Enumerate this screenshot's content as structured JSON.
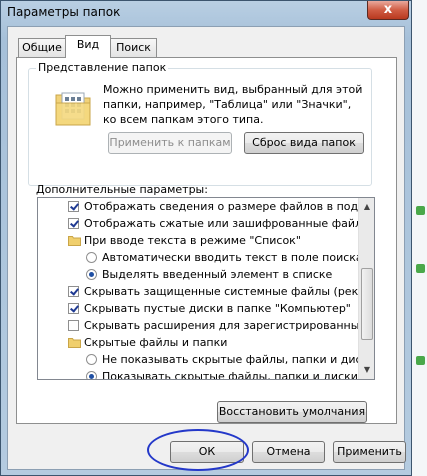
{
  "window": {
    "title": "Параметры папок",
    "close_glyph": "x"
  },
  "tabs": [
    {
      "label": "Общие",
      "active": false
    },
    {
      "label": "Вид",
      "active": true
    },
    {
      "label": "Поиск",
      "active": false
    }
  ],
  "folder_views": {
    "group_title": "Представление папок",
    "icon": "folder-grid-icon",
    "description": "Можно применить вид, выбранный для этой папки, например, \"Таблица\" или \"Значки\", ко всем папкам этого типа.",
    "apply_button": "Применить к папкам",
    "apply_enabled": false,
    "reset_button": "Сброс вида папок"
  },
  "advanced": {
    "label": "Дополнительные параметры:",
    "items": [
      {
        "type": "checkbox",
        "checked": true,
        "indent": 1,
        "text": "Отображать сведения о размере файлов в подсказк"
      },
      {
        "type": "checkbox",
        "checked": true,
        "indent": 1,
        "text": "Отображать сжатые или зашифрованные файлы NT"
      },
      {
        "type": "folder",
        "indent": 1,
        "text": "При вводе текста в режиме \"Список\""
      },
      {
        "type": "radio",
        "checked": false,
        "indent": 2,
        "text": "Автоматически вводить текст в поле поиска"
      },
      {
        "type": "radio",
        "checked": true,
        "indent": 2,
        "text": "Выделять введенный элемент в списке"
      },
      {
        "type": "checkbox",
        "checked": true,
        "indent": 1,
        "text": "Скрывать защищенные системные файлы (рекомен"
      },
      {
        "type": "checkbox",
        "checked": true,
        "indent": 1,
        "text": "Скрывать пустые диски в папке \"Компьютер\""
      },
      {
        "type": "checkbox",
        "checked": false,
        "indent": 1,
        "text": "Скрывать расширения для зарегистрированных типо"
      },
      {
        "type": "folder",
        "indent": 1,
        "text": "Скрытые файлы и папки"
      },
      {
        "type": "radio",
        "checked": false,
        "indent": 2,
        "text": "Не показывать скрытые файлы, папки и диски"
      },
      {
        "type": "radio",
        "checked": true,
        "indent": 2,
        "text": "Показывать скрытые файлы, папки и диски"
      }
    ],
    "restore_button": "Восстановить умолчания"
  },
  "footer": {
    "ok": "ОК",
    "cancel": "Отмена",
    "apply": "Применить"
  },
  "colors": {
    "annotation": "#2438c9",
    "close": "#c84a32"
  }
}
